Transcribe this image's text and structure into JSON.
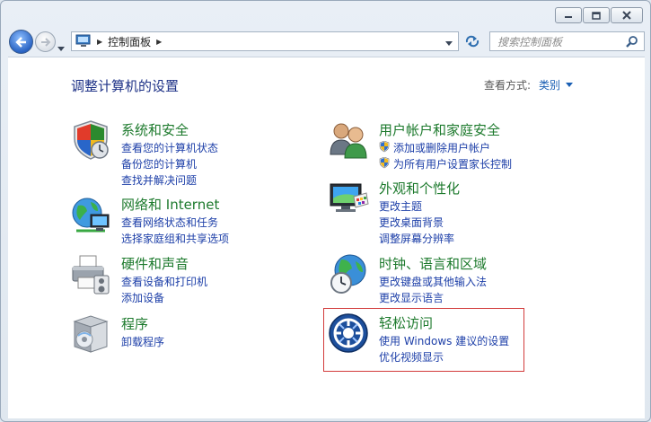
{
  "window": {
    "breadcrumb": "控制面板",
    "search_placeholder": "搜索控制面板"
  },
  "header": {
    "title": "调整计算机的设置",
    "view_by_label": "查看方式:",
    "view_by_value": "类别"
  },
  "categories": {
    "system": {
      "title": "系统和安全",
      "links": [
        "查看您的计算机状态",
        "备份您的计算机",
        "查找并解决问题"
      ]
    },
    "network": {
      "title": "网络和 Internet",
      "links": [
        "查看网络状态和任务",
        "选择家庭组和共享选项"
      ]
    },
    "hardware": {
      "title": "硬件和声音",
      "links": [
        "查看设备和打印机",
        "添加设备"
      ]
    },
    "programs": {
      "title": "程序",
      "links": [
        "卸载程序"
      ]
    },
    "users": {
      "title": "用户帐户和家庭安全",
      "links": [
        "添加或删除用户帐户",
        "为所有用户设置家长控制"
      ]
    },
    "appearance": {
      "title": "外观和个性化",
      "links": [
        "更改主题",
        "更改桌面背景",
        "调整屏幕分辨率"
      ]
    },
    "clock": {
      "title": "时钟、语言和区域",
      "links": [
        "更改键盘或其他输入法",
        "更改显示语言"
      ]
    },
    "ease": {
      "title": "轻松访问",
      "links": [
        "使用 Windows 建议的设置",
        "优化视频显示"
      ]
    }
  },
  "colors": {
    "category_title": "#1d7a2d",
    "link": "#1d3fa8",
    "page_title": "#1e3287",
    "highlight_border": "#d23b3b"
  },
  "icons": {
    "system": "shield-icon",
    "network": "network-globe-icon",
    "hardware": "printer-icon",
    "programs": "programs-box-icon",
    "users": "users-icon",
    "appearance": "monitor-palette-icon",
    "clock": "globe-clock-icon",
    "ease": "ease-of-access-icon"
  }
}
